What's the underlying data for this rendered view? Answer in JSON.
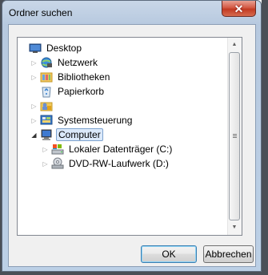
{
  "window": {
    "title": "Ordner suchen",
    "close_glyph": "✕"
  },
  "tree": {
    "items": [
      {
        "label": "Desktop",
        "icon": "desktop-icon",
        "expander": ""
      },
      {
        "label": "Netzwerk",
        "icon": "network-icon",
        "expander": "▷"
      },
      {
        "label": "Bibliotheken",
        "icon": "libraries-icon",
        "expander": "▷"
      },
      {
        "label": "Papierkorb",
        "icon": "recycle-bin-icon",
        "expander": ""
      },
      {
        "label": "",
        "icon": "user-folder-icon",
        "expander": "▷"
      },
      {
        "label": "Systemsteuerung",
        "icon": "control-panel-icon",
        "expander": "▷"
      },
      {
        "label": "Computer",
        "icon": "computer-icon",
        "expander": "◢",
        "selected": true
      },
      {
        "label": "Lokaler Datenträger (C:)",
        "icon": "hard-drive-icon",
        "expander": "▷"
      },
      {
        "label": "DVD-RW-Laufwerk (D:)",
        "icon": "dvd-drive-icon",
        "expander": "▷"
      }
    ]
  },
  "scrollbar": {
    "up": "▲",
    "down": "▼"
  },
  "buttons": {
    "ok": "OK",
    "cancel": "Abbrechen"
  }
}
